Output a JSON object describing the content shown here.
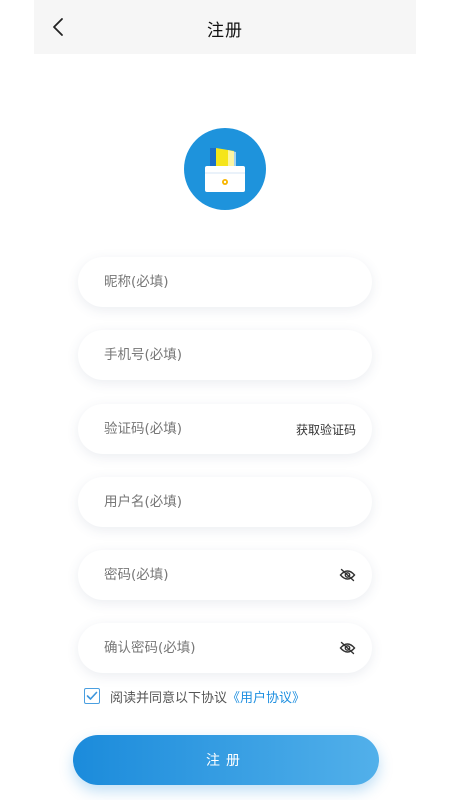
{
  "header": {
    "title": "注册"
  },
  "form": {
    "nickname_placeholder": "昵称(必填)",
    "phone_placeholder": "手机号(必填)",
    "code_placeholder": "验证码(必填)",
    "get_code_label": "获取验证码",
    "username_placeholder": "用户名(必填)",
    "password_placeholder": "密码(必填)",
    "confirm_password_placeholder": "确认密码(必填)"
  },
  "agreement": {
    "checked": true,
    "text": "阅读并同意以下协议",
    "link": "《用户协议》"
  },
  "submit_label": "注册",
  "colors": {
    "primary": "#1e93dc",
    "link": "#1e8fe0",
    "topbar": "#f6f6f6"
  },
  "icons": [
    "back-arrow-icon",
    "app-logo-icon",
    "eye-hidden-icon",
    "check-icon"
  ]
}
